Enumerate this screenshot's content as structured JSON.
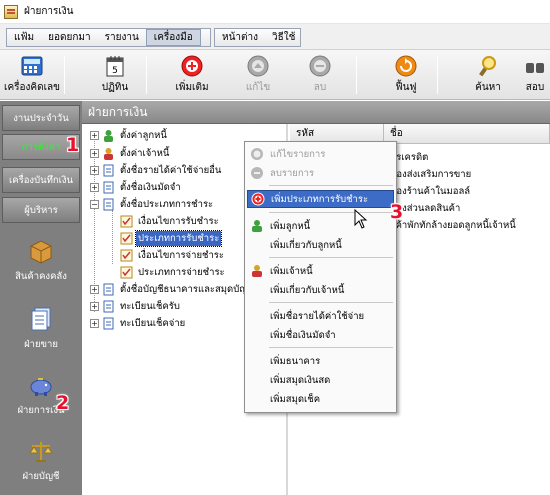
{
  "window": {
    "title": "ฝ่ายการเงิน"
  },
  "menu": {
    "items": [
      "แฟ้ม",
      "ยอดยกมา",
      "รายงาน",
      "เครื่องมือ"
    ],
    "items2": [
      "หน้าต่าง",
      "วิธีใช้"
    ]
  },
  "toolbar": {
    "calculator": "เครื่องคิดเลข",
    "calendar": "ปฏิทิน",
    "add": "เพิ่มเติม",
    "edit": "แก้ไข",
    "delete": "ลบ",
    "restore": "ฟื้นฟู",
    "search": "ค้นหา",
    "more": "สอบ"
  },
  "sidebar": {
    "daily": "งานประจำวัน",
    "settings": "การตั้งค่า",
    "recorder": "เครื่องบันทึกเงิน",
    "admin": "ผู้บริหาร",
    "inventory": "สินค้าคงคลัง",
    "sales": "ฝ่ายขาย",
    "finance": "ฝ่ายการเงิน",
    "accounting": "ฝ่ายบัญชี"
  },
  "panel": {
    "title": "ฝ่ายการเงิน"
  },
  "tree": [
    "ตั้งค่าลูกหนี้",
    "ตั้งค่าเจ้าหนี้",
    "ตั้งชื่อรายได้ค่าใช้จ่ายอื่น",
    "ตั้งชื่อเงินมัดจำ",
    "ตั้งชื่อประเภทการชำระ",
    "เงื่อนไขการรับชำระ",
    "ประเภทการรับชำระ",
    "เงื่อนไขการจ่ายชำระ",
    "ประเภทการจ่ายชำระ",
    "ตั้งชื่อบัญชีธนาคารและสมุดบัญชี",
    "ทะเบียนเช็ครับ",
    "ทะเบียนเช็คจ่าย"
  ],
  "list": {
    "col_code": "รหัส",
    "col_name": "ชื่อ",
    "rows": [
      "บัตรเครดิต",
      "คูปองส่งเสริมการขาย",
      "คูปองร้านค้าในมอลล์",
      "คูปองส่วนลดสินค้า",
      "ลูกค้าพักทักล้างยอดลูกหนี้เจ้าหนี้"
    ]
  },
  "context_menu": {
    "edit": "แก้ไขรายการ",
    "delete": "ลบรายการ",
    "add_payment_type": "เพิ่มประเภทการรับชำระ",
    "add_debtor": "เพิ่มลูกหนี้",
    "add_debtor_related": "เพิ่มเกี่ยวกับลูกหนี้",
    "add_creditor": "เพิ่มเจ้าหนี้",
    "add_creditor_related": "เพิ่มเกี่ยวกับเจ้าหนี้",
    "add_income_expense": "เพิ่มชื่อรายได้ค่าใช้จ่าย",
    "add_deposit": "เพิ่มชื่อเงินมัดจำ",
    "add_bank": "เพิ่มธนาคาร",
    "add_cash_book": "เพิ่มสมุดเงินสด",
    "add_check_book": "เพิ่มสมุดเช็ค"
  },
  "badges": {
    "one": "1",
    "two": "2",
    "three": "3"
  },
  "colors": {
    "selection": "#3d6cc7",
    "badge": "#e8112d",
    "active_sidebar_text": "#1cff1c"
  }
}
